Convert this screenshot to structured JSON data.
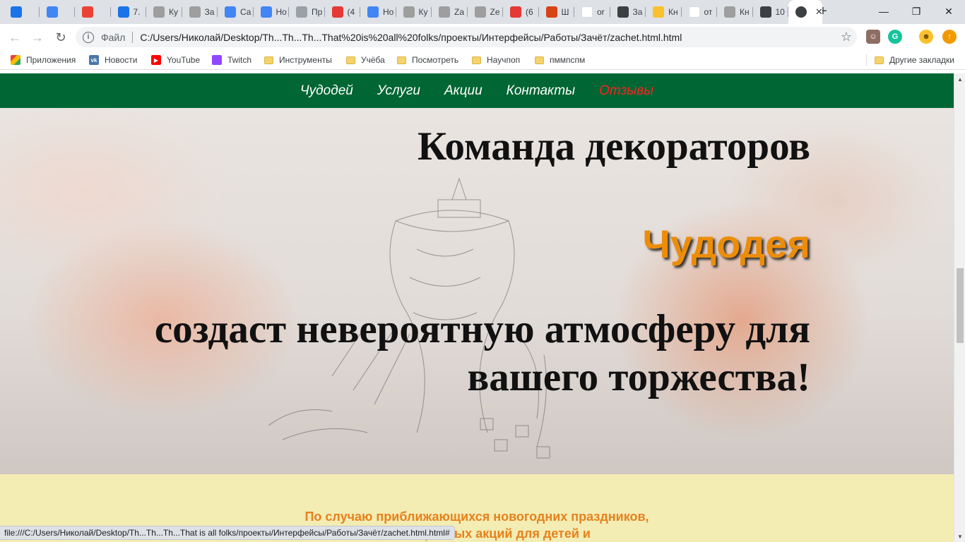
{
  "browser": {
    "tabs": [
      {
        "title": "",
        "icon": "chat-icon",
        "color": "#1a73e8"
      },
      {
        "title": "",
        "icon": "translate-icon",
        "color": "#4285f4"
      },
      {
        "title": "",
        "icon": "gmail-icon",
        "color": "#ea4335"
      },
      {
        "title": "7.",
        "icon": "contacts-icon",
        "color": "#1a73e8"
      },
      {
        "title": "Ку",
        "icon": "site-icon",
        "color": "#9e9e9e"
      },
      {
        "title": "За",
        "icon": "site-icon",
        "color": "#9e9e9e"
      },
      {
        "title": "Са",
        "icon": "forms-icon",
        "color": "#4285f4"
      },
      {
        "title": "Но",
        "icon": "docs-icon",
        "color": "#4285f4"
      },
      {
        "title": "Пр",
        "icon": "pen-icon",
        "color": "#9aa0a6"
      },
      {
        "title": "(4",
        "icon": "youtube-icon",
        "color": "#e53935"
      },
      {
        "title": "Но",
        "icon": "docs-icon",
        "color": "#4285f4"
      },
      {
        "title": "Ку",
        "icon": "site-icon",
        "color": "#9e9e9e"
      },
      {
        "title": "Za",
        "icon": "site-icon",
        "color": "#9e9e9e"
      },
      {
        "title": "Ze",
        "icon": "site-icon",
        "color": "#9e9e9e"
      },
      {
        "title": "(6",
        "icon": "youtube-icon",
        "color": "#e53935"
      },
      {
        "title": "Ш",
        "icon": "person-icon",
        "color": "#d84315"
      },
      {
        "title": "or",
        "icon": "google-icon",
        "color": "#ffffff"
      },
      {
        "title": "За",
        "icon": "globe-icon",
        "color": "#3c4043"
      },
      {
        "title": "Кн",
        "icon": "emoji-icon",
        "color": "#fbc02d"
      },
      {
        "title": "от",
        "icon": "google-icon",
        "color": "#ffffff"
      },
      {
        "title": "Кн",
        "icon": "word-icon",
        "color": "#9e9e9e"
      },
      {
        "title": "10",
        "icon": "globe-icon",
        "color": "#3c4043"
      }
    ],
    "active_tab": {
      "title": "",
      "icon": "globe-icon"
    },
    "new_tab_label": "+",
    "window_controls": {
      "minimize": "—",
      "maximize": "❐",
      "close": "✕"
    },
    "omnibox": {
      "scheme": "Файл",
      "url": "C:/Users/Николай/Desktop/Th...Th...Th...That%20is%20all%20folks/проекты/Интерфейсы/Работы/Зачёт/zachet.html.html"
    },
    "bookmarks": [
      {
        "label": "Приложения",
        "icon": "apps-icon"
      },
      {
        "label": "Новости",
        "icon": "vk-icon"
      },
      {
        "label": "YouTube",
        "icon": "youtube-icon"
      },
      {
        "label": "Twitch",
        "icon": "twitch-icon"
      },
      {
        "label": "Инструменты",
        "icon": "folder-icon"
      },
      {
        "label": "Учёба",
        "icon": "folder-icon"
      },
      {
        "label": "Посмотреть",
        "icon": "folder-icon"
      },
      {
        "label": "Научпоп",
        "icon": "folder-icon"
      },
      {
        "label": "пммпспм",
        "icon": "folder-icon"
      }
    ],
    "other_bookmarks": "Другие закладки",
    "status_url": "file:///C:/Users/Николай/Desktop/Th...Th...Th...That is all folks/проекты/Интерфейсы/Работы/Зачёт/zachet.html.html#"
  },
  "site": {
    "nav": [
      {
        "label": "Чудодей"
      },
      {
        "label": "Услуги"
      },
      {
        "label": "Акции"
      },
      {
        "label": "Контакты"
      },
      {
        "label": "Отзывы",
        "current": true
      }
    ],
    "hero": {
      "title": "Команда декораторов",
      "brand": "Чудодея",
      "tagline": "создаст невероятную атмосферу для вашего торжества!"
    },
    "promo": {
      "line1": "По случаю приближающихся новогодних праздников,",
      "line2": "ых и интересных акций для детей и"
    }
  },
  "colors": {
    "nav_bg": "#006633",
    "nav_current": "#ff2020",
    "brand_orange": "#ec8d0a",
    "promo_bg": "#f3ecb3",
    "promo_text": "#e5821e"
  }
}
